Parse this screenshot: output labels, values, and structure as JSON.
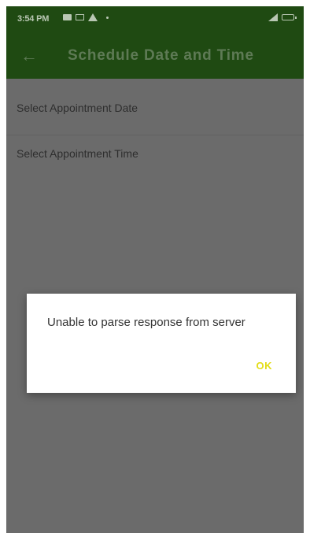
{
  "status_bar": {
    "time": "3:54 PM",
    "left_icons": [
      "message-icon",
      "screen-icon",
      "warning-icon",
      "dot-icon"
    ],
    "right_icons": [
      "signal-icon",
      "battery-icon"
    ]
  },
  "app_bar": {
    "back_icon": "arrow-left-icon",
    "back_glyph": "←",
    "title": "Schedule Date and Time",
    "color": "#1f4a12"
  },
  "form": {
    "date_label": "Select Appointment Date",
    "time_label": "Select Appointment Time"
  },
  "dialog": {
    "message": "Unable to parse response from server",
    "ok_label": "OK",
    "ok_color": "#e3dd18"
  },
  "colors": {
    "overlay": "#6b6b6b",
    "app_bar": "#1f4a12",
    "dialog_background": "#ffffff"
  }
}
